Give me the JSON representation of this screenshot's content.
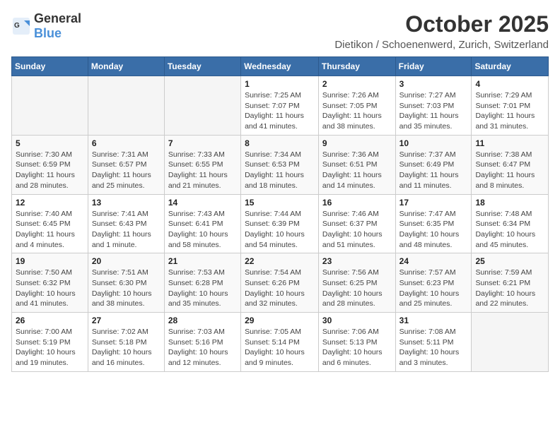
{
  "header": {
    "logo_general": "General",
    "logo_blue": "Blue",
    "month_year": "October 2025",
    "location": "Dietikon / Schoenenwerd, Zurich, Switzerland"
  },
  "days_of_week": [
    "Sunday",
    "Monday",
    "Tuesday",
    "Wednesday",
    "Thursday",
    "Friday",
    "Saturday"
  ],
  "weeks": [
    [
      {
        "day": "",
        "info": ""
      },
      {
        "day": "",
        "info": ""
      },
      {
        "day": "",
        "info": ""
      },
      {
        "day": "1",
        "info": "Sunrise: 7:25 AM\nSunset: 7:07 PM\nDaylight: 11 hours\nand 41 minutes."
      },
      {
        "day": "2",
        "info": "Sunrise: 7:26 AM\nSunset: 7:05 PM\nDaylight: 11 hours\nand 38 minutes."
      },
      {
        "day": "3",
        "info": "Sunrise: 7:27 AM\nSunset: 7:03 PM\nDaylight: 11 hours\nand 35 minutes."
      },
      {
        "day": "4",
        "info": "Sunrise: 7:29 AM\nSunset: 7:01 PM\nDaylight: 11 hours\nand 31 minutes."
      }
    ],
    [
      {
        "day": "5",
        "info": "Sunrise: 7:30 AM\nSunset: 6:59 PM\nDaylight: 11 hours\nand 28 minutes."
      },
      {
        "day": "6",
        "info": "Sunrise: 7:31 AM\nSunset: 6:57 PM\nDaylight: 11 hours\nand 25 minutes."
      },
      {
        "day": "7",
        "info": "Sunrise: 7:33 AM\nSunset: 6:55 PM\nDaylight: 11 hours\nand 21 minutes."
      },
      {
        "day": "8",
        "info": "Sunrise: 7:34 AM\nSunset: 6:53 PM\nDaylight: 11 hours\nand 18 minutes."
      },
      {
        "day": "9",
        "info": "Sunrise: 7:36 AM\nSunset: 6:51 PM\nDaylight: 11 hours\nand 14 minutes."
      },
      {
        "day": "10",
        "info": "Sunrise: 7:37 AM\nSunset: 6:49 PM\nDaylight: 11 hours\nand 11 minutes."
      },
      {
        "day": "11",
        "info": "Sunrise: 7:38 AM\nSunset: 6:47 PM\nDaylight: 11 hours\nand 8 minutes."
      }
    ],
    [
      {
        "day": "12",
        "info": "Sunrise: 7:40 AM\nSunset: 6:45 PM\nDaylight: 11 hours\nand 4 minutes."
      },
      {
        "day": "13",
        "info": "Sunrise: 7:41 AM\nSunset: 6:43 PM\nDaylight: 11 hours\nand 1 minute."
      },
      {
        "day": "14",
        "info": "Sunrise: 7:43 AM\nSunset: 6:41 PM\nDaylight: 10 hours\nand 58 minutes."
      },
      {
        "day": "15",
        "info": "Sunrise: 7:44 AM\nSunset: 6:39 PM\nDaylight: 10 hours\nand 54 minutes."
      },
      {
        "day": "16",
        "info": "Sunrise: 7:46 AM\nSunset: 6:37 PM\nDaylight: 10 hours\nand 51 minutes."
      },
      {
        "day": "17",
        "info": "Sunrise: 7:47 AM\nSunset: 6:35 PM\nDaylight: 10 hours\nand 48 minutes."
      },
      {
        "day": "18",
        "info": "Sunrise: 7:48 AM\nSunset: 6:34 PM\nDaylight: 10 hours\nand 45 minutes."
      }
    ],
    [
      {
        "day": "19",
        "info": "Sunrise: 7:50 AM\nSunset: 6:32 PM\nDaylight: 10 hours\nand 41 minutes."
      },
      {
        "day": "20",
        "info": "Sunrise: 7:51 AM\nSunset: 6:30 PM\nDaylight: 10 hours\nand 38 minutes."
      },
      {
        "day": "21",
        "info": "Sunrise: 7:53 AM\nSunset: 6:28 PM\nDaylight: 10 hours\nand 35 minutes."
      },
      {
        "day": "22",
        "info": "Sunrise: 7:54 AM\nSunset: 6:26 PM\nDaylight: 10 hours\nand 32 minutes."
      },
      {
        "day": "23",
        "info": "Sunrise: 7:56 AM\nSunset: 6:25 PM\nDaylight: 10 hours\nand 28 minutes."
      },
      {
        "day": "24",
        "info": "Sunrise: 7:57 AM\nSunset: 6:23 PM\nDaylight: 10 hours\nand 25 minutes."
      },
      {
        "day": "25",
        "info": "Sunrise: 7:59 AM\nSunset: 6:21 PM\nDaylight: 10 hours\nand 22 minutes."
      }
    ],
    [
      {
        "day": "26",
        "info": "Sunrise: 7:00 AM\nSunset: 5:19 PM\nDaylight: 10 hours\nand 19 minutes."
      },
      {
        "day": "27",
        "info": "Sunrise: 7:02 AM\nSunset: 5:18 PM\nDaylight: 10 hours\nand 16 minutes."
      },
      {
        "day": "28",
        "info": "Sunrise: 7:03 AM\nSunset: 5:16 PM\nDaylight: 10 hours\nand 12 minutes."
      },
      {
        "day": "29",
        "info": "Sunrise: 7:05 AM\nSunset: 5:14 PM\nDaylight: 10 hours\nand 9 minutes."
      },
      {
        "day": "30",
        "info": "Sunrise: 7:06 AM\nSunset: 5:13 PM\nDaylight: 10 hours\nand 6 minutes."
      },
      {
        "day": "31",
        "info": "Sunrise: 7:08 AM\nSunset: 5:11 PM\nDaylight: 10 hours\nand 3 minutes."
      },
      {
        "day": "",
        "info": ""
      }
    ]
  ]
}
